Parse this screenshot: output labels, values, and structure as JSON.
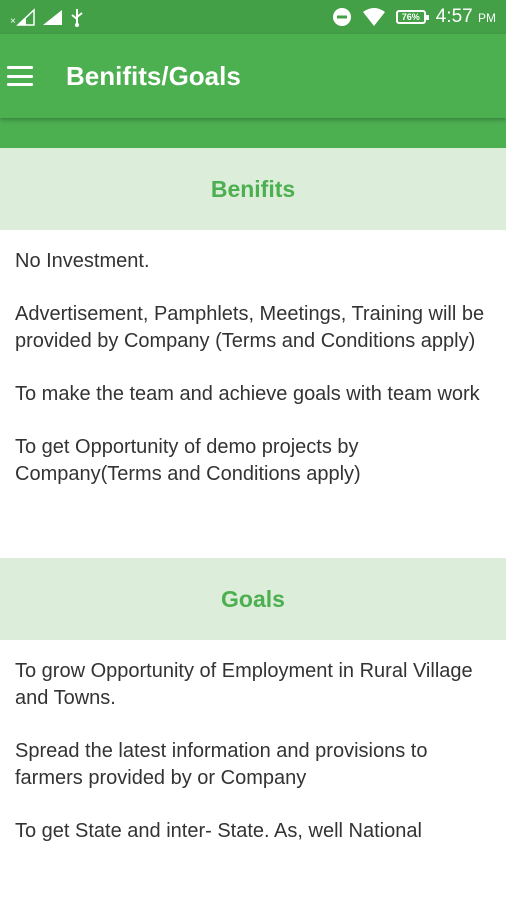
{
  "status_bar": {
    "time": "4:57",
    "ampm": "PM",
    "battery": "76%",
    "icons": [
      "no-sim-signal-icon",
      "signal-icon",
      "usb-icon",
      "dnd-icon",
      "wifi-icon",
      "battery-icon"
    ]
  },
  "app_bar": {
    "title": "Benifits/Goals",
    "menu_icon": "hamburger-menu-icon"
  },
  "colors": {
    "primary": "#4caf50",
    "primary_dark": "#43a047",
    "section_header_bg": "#dcedda",
    "text": "#333333"
  },
  "benefits": {
    "title": "Benifits",
    "items": [
      "No Investment.",
      " Advertisement, Pamphlets, Meetings, Training will be provided by Company (Terms and Conditions apply)",
      " To make the team and achieve goals with team work",
      " To get Opportunity of demo projects by Company(Terms and Conditions apply)"
    ]
  },
  "goals": {
    "title": "Goals",
    "items": [
      "To grow Opportunity of Employment in Rural Village and Towns.",
      " Spread the latest information and provisions to farmers provided by or Company",
      " To get State and inter- State. As, well National"
    ]
  }
}
